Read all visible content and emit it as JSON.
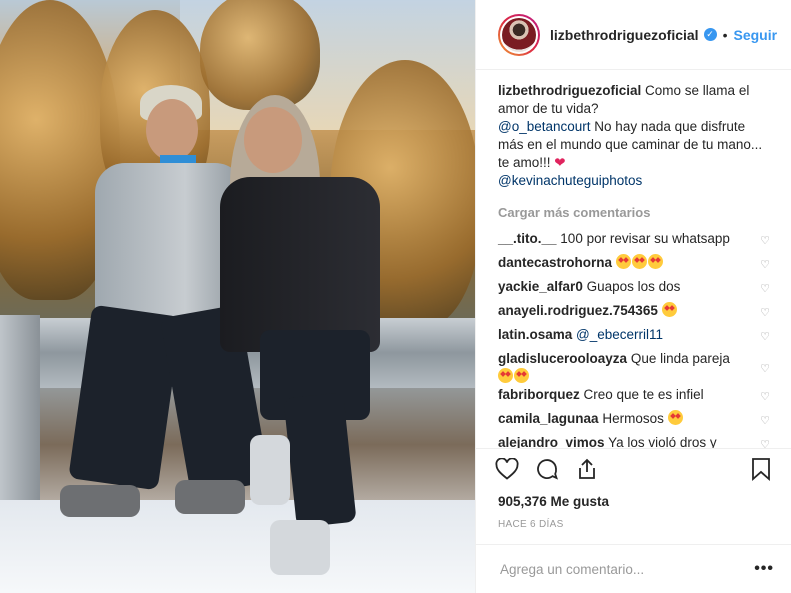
{
  "header": {
    "username": "lizbethrodriguezoficial",
    "separator": "•",
    "follow_label": "Seguir",
    "verified_mark": "✓"
  },
  "caption": {
    "username": "lizbethrodriguezoficial",
    "text1": "Como se llama el amor de tu vida?",
    "mention1": "@o_betancourt",
    "text2": "No hay nada que disfrute más en el mundo que caminar de tu mano... te amo!!!",
    "heart": "❤",
    "mention2": "@kevinachuteguiphotos"
  },
  "load_more": "Cargar más comentarios",
  "comments": [
    {
      "user": "__.tito.__",
      "text": "100 por revisar su whatsapp"
    },
    {
      "user": "dantecastrohorna",
      "text": ""
    },
    {
      "user": "yackie_alfar0",
      "text": "Guapos los dos"
    },
    {
      "user": "anayeli.rodriguez.754365",
      "text": ""
    },
    {
      "user": "latin.osama",
      "text": "@_ebecerril11"
    },
    {
      "user": "gladislucerooloayza",
      "text": "Que linda pareja"
    },
    {
      "user": "fabriborquez",
      "text": "Creo que te es infiel"
    },
    {
      "user": "camila_lagunaa",
      "text": "Hermosos"
    },
    {
      "user": "alejandro_vimos",
      "text": "Ya los violó dros y"
    }
  ],
  "likes": "905,376 Me gusta",
  "time": "HACE 6 DÍAS",
  "add_comment_placeholder": "Agrega un comentario...",
  "more_label": "•••",
  "comment_heart": "♡",
  "icons": [
    "heart-icon",
    "comment-icon",
    "share-icon",
    "bookmark-icon",
    "verified-icon",
    "more-icon"
  ]
}
